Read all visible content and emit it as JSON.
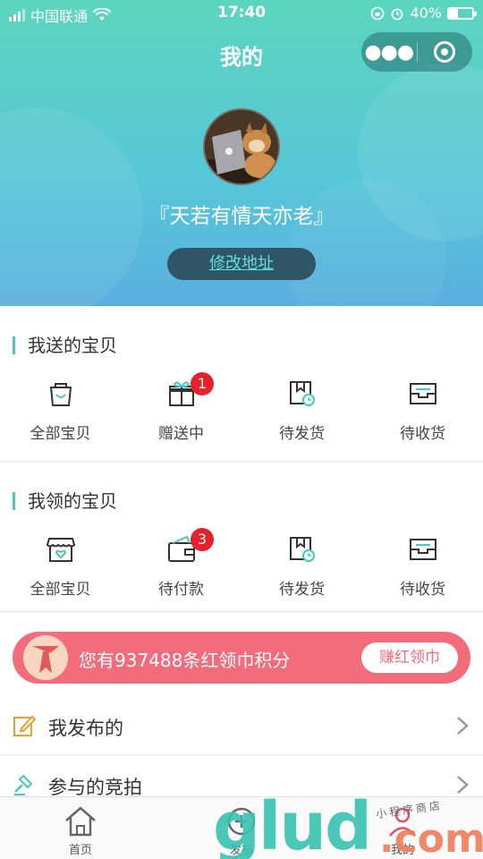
{
  "status_bar": {
    "carrier": "中国联通",
    "time": "17:40",
    "battery": "40%"
  },
  "nav": {
    "title": "我的",
    "more_icon": "more-dots-icon",
    "close_icon": "target-circle-icon"
  },
  "profile": {
    "name": "『天若有情天亦老』",
    "address_button": "修改地址"
  },
  "sent_section": {
    "title": "我送的宝贝",
    "items": [
      {
        "label": "全部宝贝",
        "icon": "bag-icon"
      },
      {
        "label": "赠送中",
        "icon": "gift-icon",
        "badge": "1"
      },
      {
        "label": "待发货",
        "icon": "box-clock-icon"
      },
      {
        "label": "待收货",
        "icon": "inbox-icon"
      }
    ]
  },
  "received_section": {
    "title": "我领的宝贝",
    "items": [
      {
        "label": "全部宝贝",
        "icon": "shop-heart-icon"
      },
      {
        "label": "待付款",
        "icon": "wallet-icon",
        "badge": "3"
      },
      {
        "label": "待发货",
        "icon": "box-clock-icon"
      },
      {
        "label": "待收货",
        "icon": "inbox-icon"
      }
    ]
  },
  "points_banner": {
    "text": "您有937488条红领巾积分",
    "button": "赚红领巾"
  },
  "menu": [
    {
      "label": "我发布的",
      "icon": "edit-icon"
    },
    {
      "label": "参与的竞拍",
      "icon": "gavel-icon"
    }
  ],
  "tabbar": [
    {
      "label": "首页",
      "icon": "home-icon"
    },
    {
      "label": "发布",
      "icon": "publish-icon"
    },
    {
      "label": "我的",
      "icon": "person-icon"
    }
  ],
  "watermark": {
    "main": "glud",
    "suffix": ".com",
    "small": "小程序商店"
  },
  "colors": {
    "accent": "#46c7c0",
    "badge": "#e6212c",
    "points_bg": "#f26c7b",
    "header_top": "#5bd6bd",
    "header_bottom": "#5aaedf"
  }
}
